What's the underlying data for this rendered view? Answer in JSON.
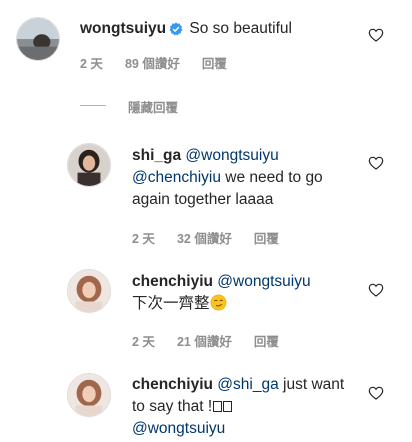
{
  "comments": [
    {
      "username": "wongtsuiyu",
      "verified": true,
      "text": "So so beautiful",
      "time": "2 天",
      "likes": "89 個讚好",
      "reply_label": "回覆"
    },
    {
      "username": "shi_ga",
      "mention1": "@wongtsuiyu",
      "mention2": "@chenchiyiu",
      "text_after": "we need to go again together laaaa",
      "time": "2 天",
      "likes": "32 個讚好",
      "reply_label": "回覆"
    },
    {
      "username": "chenchiyiu",
      "mention1": "@wongtsuiyu",
      "text": "下次一齊整",
      "emoji": "smirk-emoji",
      "time": "2 天",
      "likes": "21 個讚好",
      "reply_label": "回覆"
    },
    {
      "username": "chenchiyiu",
      "mention1": "@shi_ga",
      "text_mid": "just want to say that !",
      "mention2": "@wongtsuiyu"
    }
  ],
  "hide_replies_label": "隱藏回覆",
  "icons": {
    "like": "heart-outline-icon",
    "verified": "verified-badge-icon"
  },
  "colors": {
    "text": "#262626",
    "meta": "#8e8e8e",
    "mention": "#00376b",
    "verified": "#3897f0"
  }
}
